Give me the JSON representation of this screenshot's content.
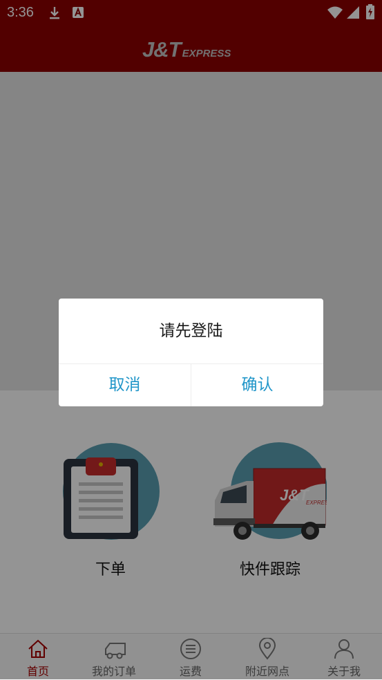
{
  "status_bar": {
    "time": "3:36",
    "icons": [
      "download-icon",
      "font-notification-icon",
      "wifi-icon",
      "signal-icon",
      "battery-charging-icon"
    ]
  },
  "header": {
    "logo_main": "J&T",
    "logo_sub": "EXPRESS",
    "brand_color": "#8e0000"
  },
  "features": [
    {
      "label": "下单",
      "icon": "clipboard-icon"
    },
    {
      "label": "快件跟踪",
      "icon": "truck-icon",
      "truck_text": "J&T",
      "truck_sub": "EXPRESS"
    }
  ],
  "tabbar": {
    "tabs": [
      {
        "label": "首页",
        "icon": "home-icon",
        "active": true
      },
      {
        "label": "我的订单",
        "icon": "order-truck-icon",
        "active": false
      },
      {
        "label": "运费",
        "icon": "list-icon",
        "active": false
      },
      {
        "label": "附近网点",
        "icon": "location-pin-icon",
        "active": false
      },
      {
        "label": "关于我",
        "icon": "person-icon",
        "active": false
      }
    ],
    "active_color": "#a80000"
  },
  "dialog": {
    "message": "请先登陆",
    "cancel_label": "取消",
    "confirm_label": "确认",
    "button_color": "#2196c9"
  }
}
